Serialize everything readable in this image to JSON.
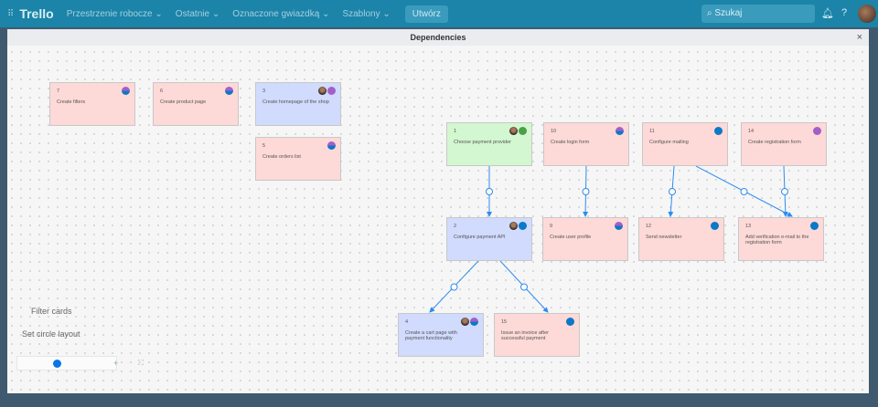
{
  "topbar": {
    "app": "Trello",
    "nav": [
      "Przestrzenie robocze",
      "Ostatnie",
      "Oznaczone gwiazdką",
      "Szablony"
    ],
    "create": "Utwórz",
    "search_placeholder": "Szukaj"
  },
  "modal": {
    "title": "Dependencies",
    "close": "×"
  },
  "cards": [
    {
      "num": "7",
      "title": "Create filters",
      "color": "pink"
    },
    {
      "num": "6",
      "title": "Create product page",
      "color": "pink"
    },
    {
      "num": "3",
      "title": "Create homepage of the shop",
      "color": "blue"
    },
    {
      "num": "5",
      "title": "Create orders list",
      "color": "pink"
    },
    {
      "num": "1",
      "title": "Choose payment provider",
      "color": "green"
    },
    {
      "num": "10",
      "title": "Create login form",
      "color": "pink"
    },
    {
      "num": "11",
      "title": "Configure mailing",
      "color": "pink"
    },
    {
      "num": "14",
      "title": "Create registration form",
      "color": "pink"
    },
    {
      "num": "2",
      "title": "Configure payment API",
      "color": "blue"
    },
    {
      "num": "9",
      "title": "Create user profile",
      "color": "pink"
    },
    {
      "num": "12",
      "title": "Send newsletter",
      "color": "pink"
    },
    {
      "num": "13",
      "title": "Add verification e-mail to the registration form",
      "color": "pink"
    },
    {
      "num": "4",
      "title": "Create a cart page with payment functionality",
      "color": "blue"
    },
    {
      "num": "15",
      "title": "Issue an invoice after successful payment",
      "color": "pink"
    }
  ],
  "dependencies": [
    [
      "1",
      "2"
    ],
    [
      "10",
      "9"
    ],
    [
      "11",
      "12"
    ],
    [
      "11",
      "13"
    ],
    [
      "14",
      "13"
    ],
    [
      "2",
      "4"
    ],
    [
      "2",
      "15"
    ]
  ],
  "controls": {
    "filter": "Filter cards",
    "circle": "Set circle layout",
    "zoom_in": "+",
    "fit": "⛶"
  }
}
